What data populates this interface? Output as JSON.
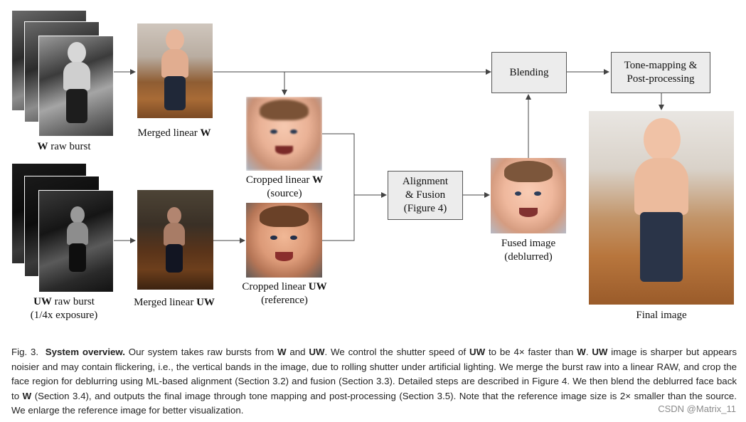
{
  "figure": {
    "labels": {
      "w_raw_burst": {
        "bold": "W",
        "text": " raw burst"
      },
      "merged_linear_w": {
        "text": "Merged linear ",
        "bold": "W"
      },
      "cropped_linear_w": {
        "text": "Cropped linear ",
        "bold": "W",
        "line2": "(source)"
      },
      "uw_raw_burst": {
        "bold": "UW",
        "text": " raw burst",
        "line2": "(1/4x exposure)"
      },
      "merged_linear_uw": {
        "text": "Merged linear ",
        "bold": "UW"
      },
      "cropped_linear_uw": {
        "text": "Cropped linear ",
        "bold": "UW",
        "line2": "(reference)"
      },
      "fused_image": {
        "line1": "Fused image",
        "line2": "(deblurred)"
      },
      "final_image": {
        "text": "Final image"
      }
    },
    "boxes": {
      "blending": {
        "line1": "Blending"
      },
      "alignment_fusion": {
        "line1": "Alignment",
        "line2": "& Fusion",
        "line3": "(Figure 4)"
      },
      "tone_mapping": {
        "line1": "Tone-mapping &",
        "line2": "Post-processing"
      }
    },
    "images": {
      "w_burst": "w-raw-burst-stack",
      "uw_burst": "uw-raw-burst-stack",
      "merged_w": "merged-linear-w-photo",
      "merged_uw": "merged-linear-uw-photo",
      "crop_w": "cropped-face-w",
      "crop_uw": "cropped-face-uw",
      "fused": "fused-face",
      "final": "final-photo"
    }
  },
  "caption": {
    "fig_number": "Fig. 3.",
    "title": "System overview.",
    "s1": " Our system takes raw bursts from ",
    "w": "W",
    "s2": " and ",
    "uw": "UW",
    "s3": ". We control the shutter speed of ",
    "s4": " to be 4× faster than ",
    "s5": ". ",
    "s6": " image is sharper but appears noisier and may contain flickering, i.e., the vertical bands in the image, due to rolling shutter under artificial lighting. We merge the burst raw into a linear RAW, and crop the face region for deblurring using ML-based alignment (Section 3.2) and fusion (Section 3.3). Detailed steps are described in Figure 4. We then blend the deblurred face back to ",
    "s7": " (Section 3.4), and outputs the final image through tone mapping and post-processing (Section 3.5). Note that the reference image size is 2× smaller than the source. We enlarge the reference image for better visualization."
  },
  "watermark": "CSDN @Matrix_11"
}
